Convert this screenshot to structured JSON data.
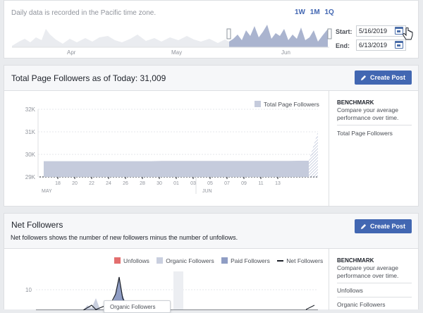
{
  "range_card": {
    "timezone_note": "Daily data is recorded in the Pacific time zone.",
    "ranges": [
      "1W",
      "1M",
      "1Q"
    ],
    "start_label": "Start:",
    "start_value": "5/16/2019",
    "end_label": "End:",
    "end_value": "6/13/2019",
    "months": [
      "Apr",
      "May",
      "Jun"
    ]
  },
  "followers_card": {
    "title": "Total Page Followers as of Today: 31,009",
    "create_post_label": "Create Post",
    "legend": [
      "Total Page Followers"
    ],
    "benchmark_title": "BENCHMARK",
    "benchmark_desc": "Compare your average performance over time.",
    "benchmark_items": [
      "Total Page Followers"
    ]
  },
  "net_card": {
    "title": "Net Followers",
    "description": "Net followers shows the number of new followers minus the number of unfollows.",
    "create_post_label": "Create Post",
    "legend": [
      "Unfollows",
      "Organic Followers",
      "Paid Followers",
      "Net Followers"
    ],
    "benchmark_title": "BENCHMARK",
    "benchmark_desc": "Compare your average performance over time.",
    "benchmark_items": [
      "Unfollows",
      "Organic Followers"
    ],
    "tooltip_label": "Organic Followers"
  },
  "colors": {
    "accent": "#4267b2",
    "series_fill": "#c5cbdc",
    "unfollows": "#e36e6e",
    "organic": "#c9cfdf",
    "paid": "#8f9dc4",
    "net": "#1d2129"
  },
  "chart_data": [
    {
      "type": "area",
      "legend": [
        "Total Page Followers"
      ],
      "y_ticks": [
        "29K",
        "30K",
        "31K",
        "32K"
      ],
      "ylim": [
        29000,
        32000
      ],
      "x_ticks": [
        "18",
        "20",
        "22",
        "24",
        "26",
        "28",
        "30",
        "01",
        "03",
        "05",
        "07",
        "09",
        "11",
        "13"
      ],
      "x_month_labels": [
        "MAY",
        "JUN"
      ],
      "series": [
        {
          "name": "Total Page Followers",
          "x": [
            "2019-05-16",
            "2019-05-17",
            "2019-05-18",
            "2019-05-19",
            "2019-05-20",
            "2019-05-21",
            "2019-05-22",
            "2019-05-23",
            "2019-05-24",
            "2019-05-25",
            "2019-05-26",
            "2019-05-27",
            "2019-05-28",
            "2019-05-29",
            "2019-05-30",
            "2019-05-31",
            "2019-06-01",
            "2019-06-02",
            "2019-06-03",
            "2019-06-04",
            "2019-06-05",
            "2019-06-06",
            "2019-06-07",
            "2019-06-08",
            "2019-06-09",
            "2019-06-10",
            "2019-06-11",
            "2019-06-12",
            "2019-06-13"
          ],
          "values": [
            29700,
            29700,
            29700,
            29700,
            29700,
            29700,
            29700,
            29700,
            29700,
            29700,
            29700,
            29700,
            29710,
            29710,
            29710,
            29710,
            29710,
            29710,
            29710,
            29710,
            29710,
            29710,
            29710,
            29710,
            29710,
            29710,
            29720,
            29720,
            31009
          ]
        }
      ]
    },
    {
      "type": "area",
      "legend": [
        "Unfollows",
        "Organic Followers",
        "Paid Followers",
        "Net Followers"
      ],
      "y_ticks": [
        "10"
      ]
    }
  ]
}
